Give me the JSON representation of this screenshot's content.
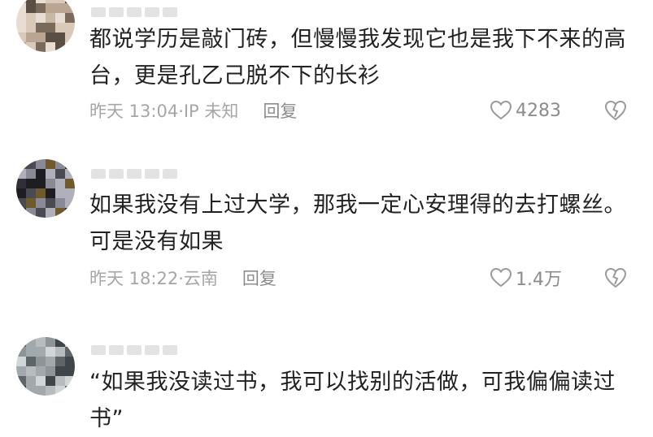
{
  "comments": [
    {
      "text": "都说学历是敲门砖，但慢慢我发现它也是我下不来的高台，更是孔乙己脱不下的长衫",
      "time": "昨天 13:04·IP 未知",
      "reply_label": "回复",
      "likes": "4283",
      "like_icon": "heart-icon",
      "dislike_icon": "broken-heart-icon"
    },
    {
      "text": "如果我没有上过大学，那我一定心安理得的去打螺丝。可是没有如果",
      "time": "昨天 18:22·云南",
      "reply_label": "回复",
      "likes": "1.4万",
      "like_icon": "heart-icon",
      "dislike_icon": "broken-heart-icon"
    },
    {
      "text": "“如果我没读过书，我可以找别的活做，可我偏偏读过书”"
    }
  ],
  "colors": {
    "text": "#222222",
    "meta": "#a6a6a6",
    "icon": "#9a9a9a"
  }
}
